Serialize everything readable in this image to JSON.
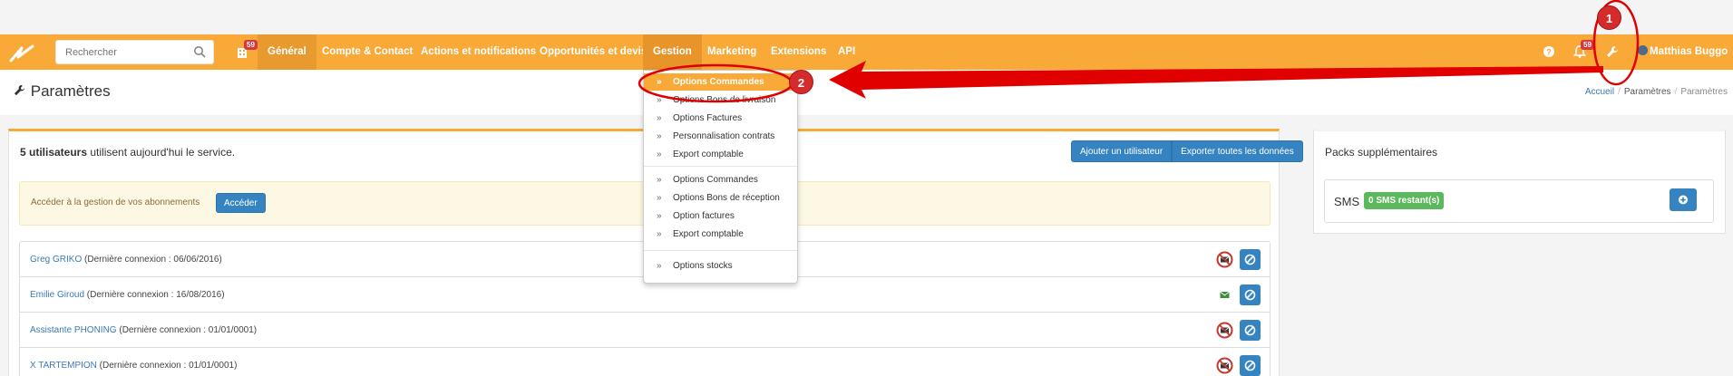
{
  "navbar": {
    "search_placeholder": "Rechercher",
    "left_badge": "59",
    "items": [
      "Général",
      "Compte & Contact",
      "Actions et notifications",
      "Opportunités et devis",
      "Gestion",
      "Marketing",
      "Extensions",
      "API"
    ],
    "notif_badge": "59",
    "user_name": "Matthias Buggo"
  },
  "page": {
    "title": "Paramètres",
    "breadcrumb": [
      "Accueil",
      "Paramètres",
      "Paramètres"
    ]
  },
  "users_panel": {
    "heading_bold": "5 utilisateurs",
    "heading_rest": " utilisent aujourd'hui le service.",
    "add_user_label": "Ajouter un utilisateur",
    "export_label": "Exporter toutes les données",
    "alert_text": "Accéder à la gestion de vos abonnements",
    "alert_button": "Accéder",
    "users": [
      {
        "name": "Greg GRIKO",
        "meta": " (Dernière connexion : 06/06/2016)",
        "mail_status": "blocked"
      },
      {
        "name": "Emilie Giroud",
        "meta": " (Dernière connexion : 16/08/2016)",
        "mail_status": "ok"
      },
      {
        "name": "Assistante PHONING",
        "meta": " (Dernière connexion : 01/01/0001)",
        "mail_status": "blocked"
      },
      {
        "name": "X TARTEMPION",
        "meta": " (Dernière connexion : 01/01/0001)",
        "mail_status": "blocked"
      }
    ]
  },
  "packs_panel": {
    "heading": "Packs supplémentaires",
    "sms_label": "SMS",
    "sms_badge": "0 SMS restant(s)"
  },
  "gestion_menu": {
    "items": [
      "Options Commandes",
      "Options Bons de livraison",
      "Options Factures",
      "Personnalisation contrats",
      "Export comptable",
      "Options Commandes",
      "Options Bons de réception",
      "Option factures",
      "Export comptable",
      "Options stocks"
    ],
    "selected_index": 0
  },
  "annotations": {
    "one": "1",
    "two": "2"
  },
  "colors": {
    "brand": "#f9a937",
    "primary_button": "#3583c0",
    "annotation": "#e00000",
    "success": "#5cb85c"
  }
}
